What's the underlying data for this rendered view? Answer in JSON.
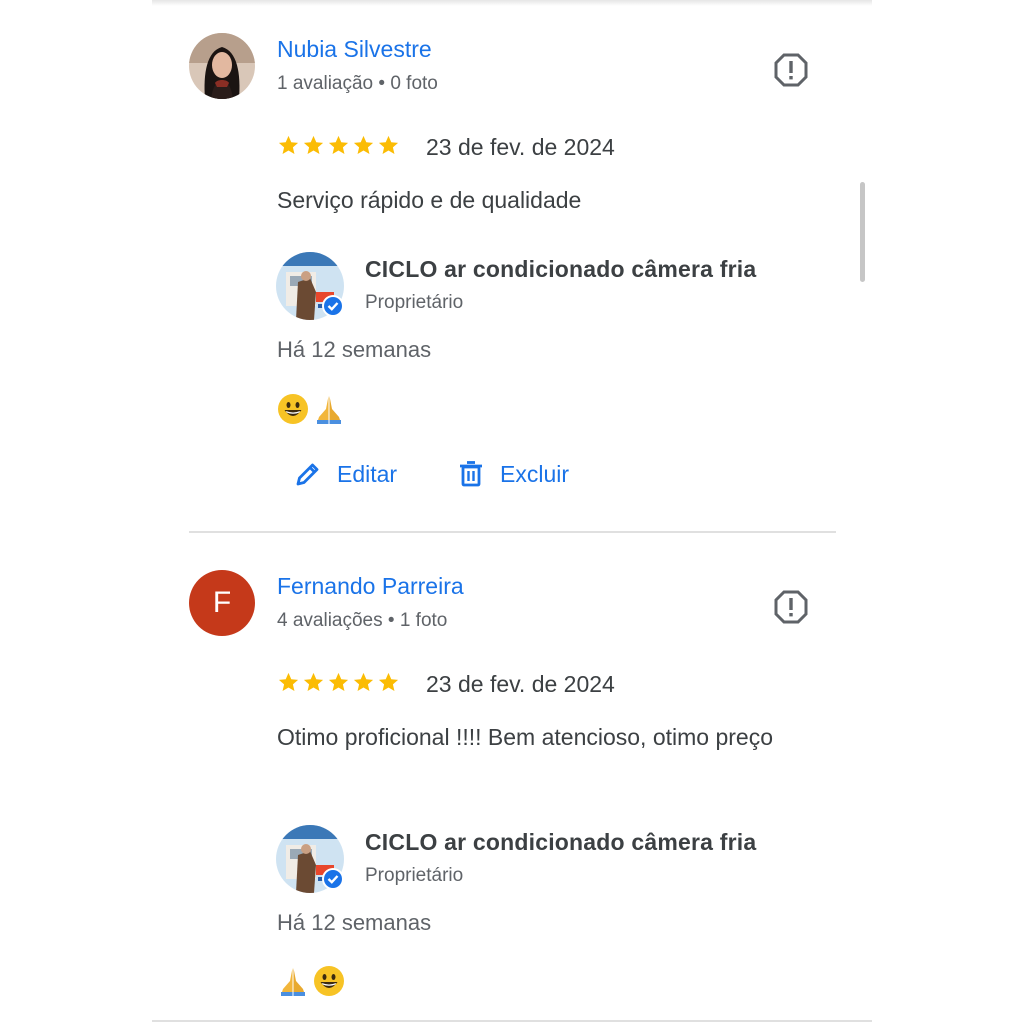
{
  "reviews": [
    {
      "reviewer_name": "Nubia Silvestre",
      "reviewer_meta": "1 avaliação • 0 foto",
      "avatar_icon": "user-photo",
      "rating": 5,
      "date": "23 de fev. de 2024",
      "text": "Serviço rápido e de qualidade",
      "owner": {
        "name": "CICLO ar condicionado câmera fria",
        "role": "Proprietário",
        "time": "Há 12 semanas",
        "reply_emoji": [
          "grinning-face",
          "folded-hands"
        ]
      },
      "actions": {
        "edit": "Editar",
        "delete": "Excluir"
      }
    },
    {
      "reviewer_name": "Fernando Parreira",
      "reviewer_meta": "4 avaliações • 1 foto",
      "avatar_letter": "F",
      "avatar_color": "#c5391a",
      "rating": 5,
      "date": "23 de fev. de 2024",
      "text": "Otimo proficional !!!! Bem atencioso, otimo preço",
      "owner": {
        "name": "CICLO ar condicionado câmera fria",
        "role": "Proprietário",
        "time": "Há 12 semanas",
        "reply_emoji": [
          "folded-hands",
          "grinning-face"
        ]
      }
    }
  ],
  "colors": {
    "link": "#1a73e8",
    "star": "#fbbc04",
    "verified": "#1a73e8"
  }
}
